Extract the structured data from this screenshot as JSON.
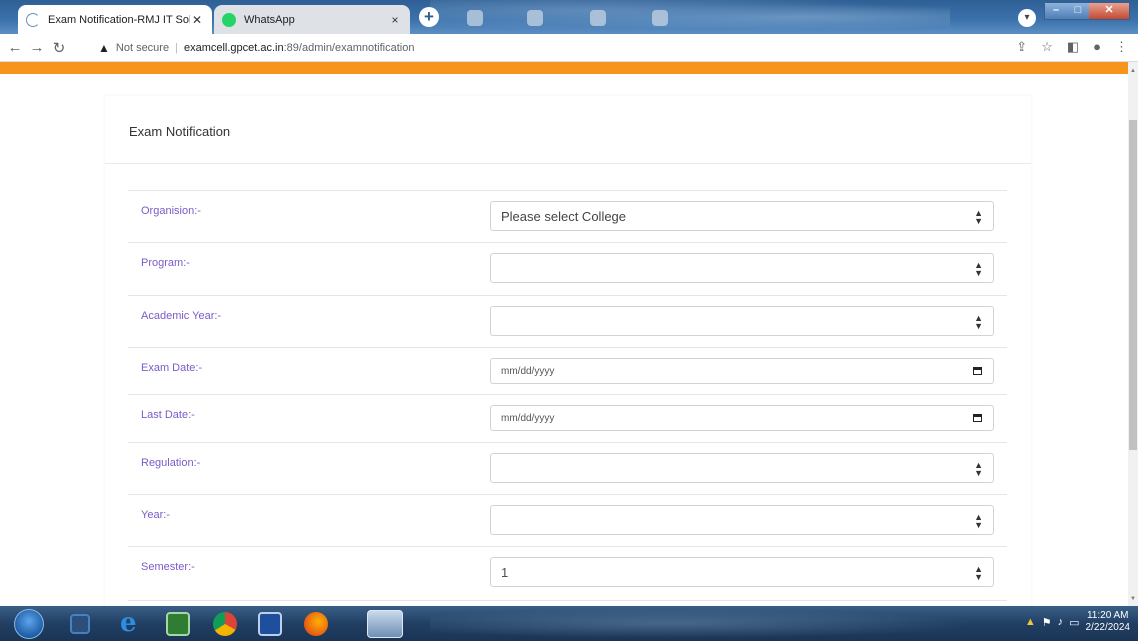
{
  "browser": {
    "tabs": [
      {
        "title": "Exam Notification-RMJ IT Solutio",
        "close": "✕"
      },
      {
        "title": "WhatsApp",
        "close": "×"
      }
    ],
    "newtab": "+",
    "tabsearch_icon": "chevron-down-icon",
    "address": {
      "security": "Not secure",
      "host": "examcell.gpcet.ac.in",
      "path": ":89/admin/examnotification"
    }
  },
  "page": {
    "card_title": "Exam Notification",
    "fields": [
      {
        "label": "Organision:-",
        "value": "Please select College",
        "type": "select"
      },
      {
        "label": "Program:-",
        "value": "",
        "type": "select"
      },
      {
        "label": "Academic Year:-",
        "value": "",
        "type": "select"
      },
      {
        "label": "Exam Date:-",
        "value": "mm/dd/yyyy",
        "type": "date"
      },
      {
        "label": "Last Date:-",
        "value": "mm/dd/yyyy",
        "type": "date"
      },
      {
        "label": "Regulation:-",
        "value": "",
        "type": "select"
      },
      {
        "label": "Year:-",
        "value": "",
        "type": "select"
      },
      {
        "label": "Semester:-",
        "value": "1",
        "type": "select"
      }
    ]
  },
  "taskbar": {
    "time": "11:20 AM",
    "date": "2/22/2024"
  },
  "colors": {
    "accent_bar": "#f7941d",
    "label": "#7a5bc8"
  }
}
